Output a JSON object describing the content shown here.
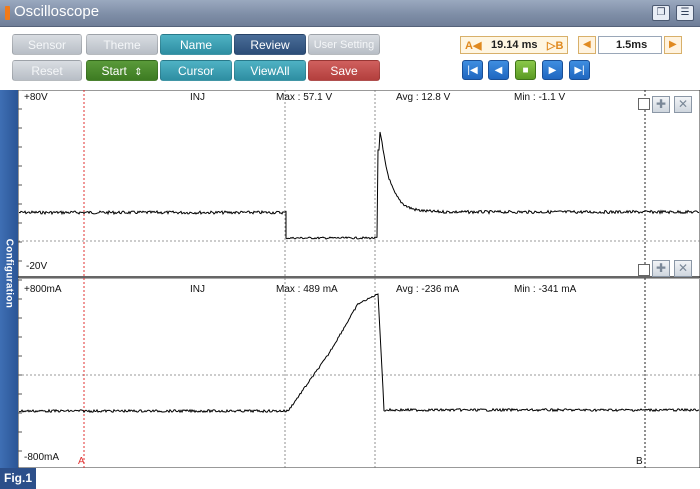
{
  "window": {
    "title": "Oscilloscope"
  },
  "toolbar": {
    "row1": [
      "Sensor",
      "Theme",
      "Name",
      "Review",
      "User Setting"
    ],
    "row2": [
      "Reset",
      "Start",
      "Cursor",
      "ViewAll",
      "Save"
    ],
    "start_arrows": "⇕"
  },
  "cursor_readout": {
    "a_label": "A◀",
    "value": "19.14 ms",
    "b_label": "▷B"
  },
  "timebase": {
    "value": "1.5ms"
  },
  "sidebar": {
    "label": "Configuration"
  },
  "channel1": {
    "top_label": "+80V",
    "bottom_label": "-20V",
    "name": "INJ",
    "max": "Max : 57.1 V",
    "avg": "Avg : 12.8 V",
    "min": "Min : -1.1 V"
  },
  "channel2": {
    "top_label": "+800mA",
    "bottom_label": "-800mA",
    "name": "INJ",
    "max": "Max : 489 mA",
    "avg": "Avg : -236 mA",
    "min": "Min : -341 mA"
  },
  "cursors": {
    "a": "A",
    "b": "B"
  },
  "figure_label": "Fig.1",
  "colors": {
    "accent": "#3f6fb4",
    "title_bar": "#7f8ea7",
    "cursor_a": "#e03030",
    "trace": "#000000"
  }
}
